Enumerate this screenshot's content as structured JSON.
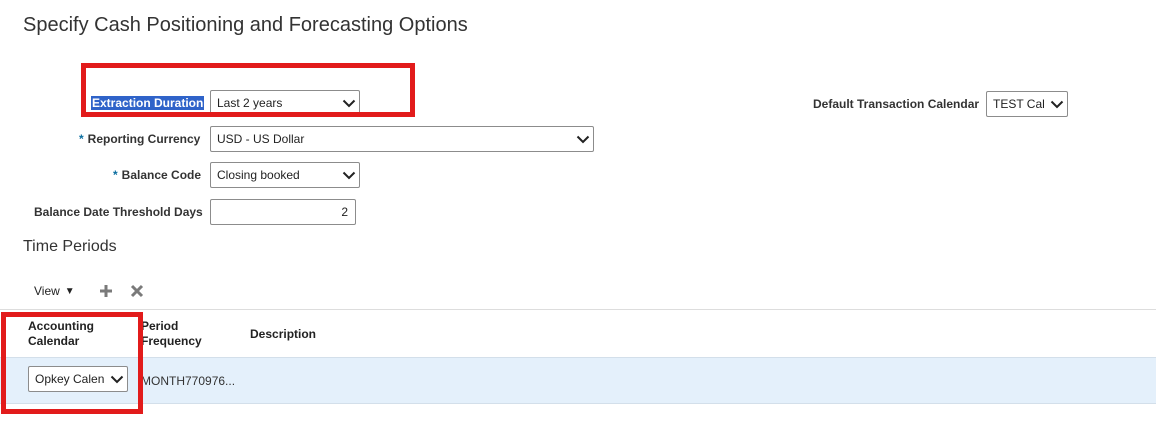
{
  "page": {
    "title": "Specify Cash Positioning and Forecasting Options"
  },
  "form": {
    "extraction_duration": {
      "label": "Extraction Duration",
      "value": "Last 2 years"
    },
    "reporting_currency": {
      "label": "Reporting Currency",
      "value": "USD - US Dollar",
      "required_marker": "*"
    },
    "balance_code": {
      "label": "Balance Code",
      "value": "Closing booked",
      "required_marker": "*"
    },
    "balance_date_threshold_days": {
      "label": "Balance Date Threshold Days",
      "value": "2"
    },
    "default_transaction_calendar": {
      "label": "Default Transaction Calendar",
      "value": "TEST Cal"
    }
  },
  "time_periods": {
    "title": "Time Periods",
    "toolbar": {
      "view_label": "View",
      "add_icon": "plus-icon",
      "delete_icon": "x-icon"
    },
    "columns": [
      {
        "line1": "Accounting",
        "line2": "Calendar"
      },
      {
        "line1": "Period",
        "line2": "Frequency"
      },
      {
        "line1": "Description",
        "line2": ""
      }
    ],
    "rows": [
      {
        "accounting_calendar": "Opkey Calen",
        "period_frequency": "MONTH770976...",
        "description": ""
      }
    ]
  },
  "colors": {
    "highlight_box": "#e21b1b",
    "selected_label_bg": "#2f63c9",
    "row_bg": "#e4f0fb",
    "required_marker": "#0b6ea0"
  }
}
